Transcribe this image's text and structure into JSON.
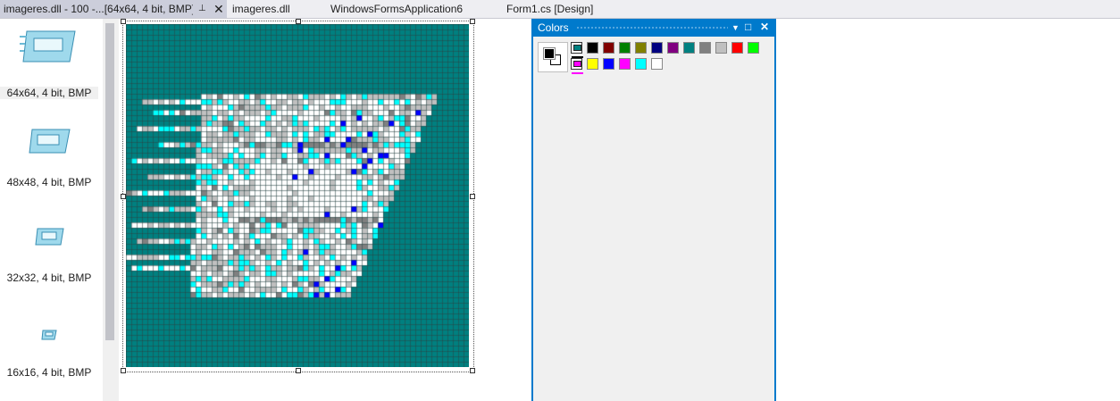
{
  "tabs": [
    {
      "label": "imageres.dll - 100 -...[64x64, 4 bit, BMP]",
      "active": true
    },
    {
      "label": "imageres.dll"
    },
    {
      "label": "WindowsFormsApplication6"
    },
    {
      "label": "Form1.cs [Design]"
    }
  ],
  "icon_list": [
    {
      "caption": "64x64, 4 bit, BMP",
      "selected": true
    },
    {
      "caption": "48x48, 4 bit, BMP"
    },
    {
      "caption": "32x32, 4 bit, BMP"
    },
    {
      "caption": "16x16, 4 bit, BMP"
    }
  ],
  "colors_window": {
    "title": "Colors",
    "foreground": "#000000",
    "background": "#ffffff",
    "screen_color": "#008080",
    "inverse_color": "#ff00ff",
    "palette_row1": [
      "#000000",
      "#800000",
      "#008000",
      "#808000",
      "#000080",
      "#800080",
      "#008080",
      "#808080",
      "#c0c0c0",
      "#ff0000",
      "#00ff00"
    ],
    "palette_row2": [
      "#ffff00",
      "#0000ff",
      "#ff00ff",
      "#00ffff",
      "#ffffff"
    ]
  },
  "colors": {
    "teal": "#008080",
    "grid": "#4d6f6f",
    "accent": "#007acc"
  }
}
